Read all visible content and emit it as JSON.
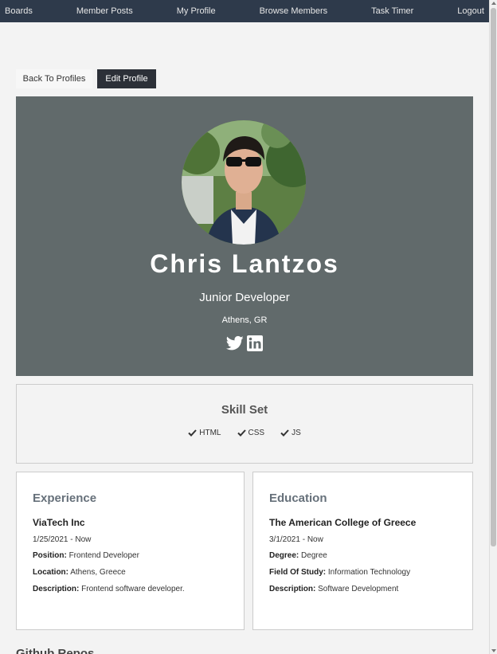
{
  "nav": {
    "items": [
      "Boards",
      "Member Posts",
      "My Profile",
      "Browse Members",
      "Task Timer",
      "Logout"
    ]
  },
  "actions": {
    "back_label": "Back To Profiles",
    "edit_label": "Edit Profile"
  },
  "profile": {
    "name": "Chris Lantzos",
    "title": "Junior Developer",
    "location": "Athens, GR",
    "socials": [
      "twitter-icon",
      "linkedin-icon"
    ]
  },
  "skills": {
    "heading": "Skill Set",
    "items": [
      "HTML",
      "CSS",
      "JS"
    ]
  },
  "experience": {
    "heading": "Experience",
    "company": "ViaTech Inc",
    "dates": "1/25/2021 - Now",
    "position_label": "Position:",
    "position": "Frontend Developer",
    "location_label": "Location:",
    "location": "Athens, Greece",
    "description_label": "Description:",
    "description": "Frontend software developer."
  },
  "education": {
    "heading": "Education",
    "school": "The American College of Greece",
    "dates": "3/1/2021 - Now",
    "degree_label": "Degree:",
    "degree": "Degree",
    "field_label": "Field Of Study:",
    "field": "Information Technology",
    "description_label": "Description:",
    "description": "Software Development"
  },
  "github": {
    "heading": "Github Repos"
  },
  "colors": {
    "navbar": "#2e3a4b",
    "hero": "#616a6b",
    "edit_button": "#2c3038"
  }
}
